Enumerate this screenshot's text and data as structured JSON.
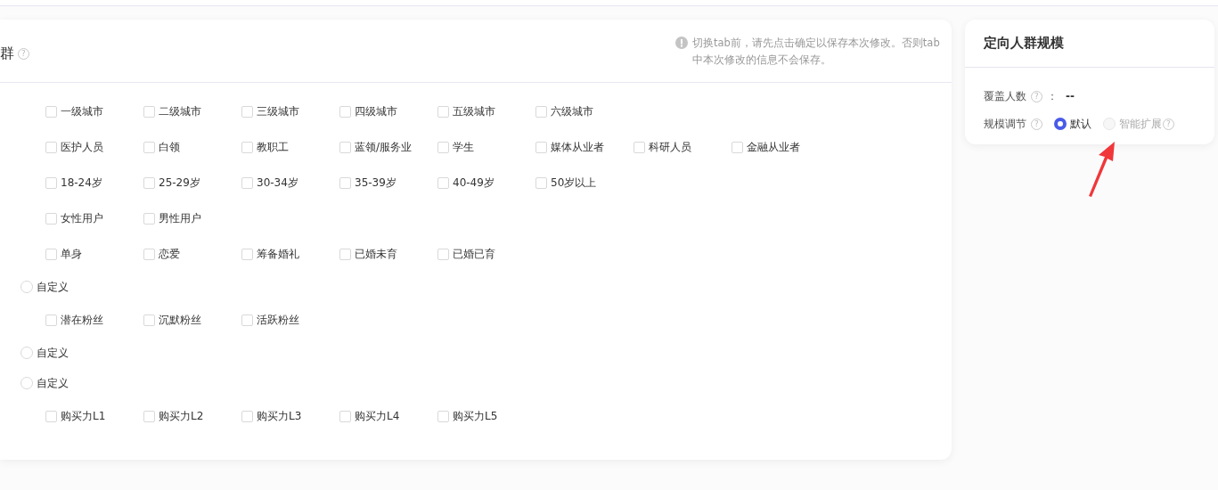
{
  "section": {
    "title": "群",
    "help": "?",
    "notice": "切换tab前，请先点击确定以保存本次修改。否则tab中本次修改的信息不会保存。",
    "rows": [
      {
        "kind": "checkboxes",
        "options": [
          {
            "label": "一级城市",
            "checked": false
          },
          {
            "label": "二级城市",
            "checked": false
          },
          {
            "label": "三级城市",
            "checked": false
          },
          {
            "label": "四级城市",
            "checked": false
          },
          {
            "label": "五级城市",
            "checked": false
          },
          {
            "label": "六级城市",
            "checked": false
          }
        ]
      },
      {
        "kind": "checkboxes",
        "options": [
          {
            "label": "医护人员",
            "checked": false
          },
          {
            "label": "白领",
            "checked": false
          },
          {
            "label": "教职工",
            "checked": false
          },
          {
            "label": "蓝领/服务业",
            "checked": false
          },
          {
            "label": "学生",
            "checked": false
          },
          {
            "label": "媒体从业者",
            "checked": false
          },
          {
            "label": "科研人员",
            "checked": false
          },
          {
            "label": "金融从业者",
            "checked": false
          }
        ]
      },
      {
        "kind": "checkboxes",
        "options": [
          {
            "label": "18-24岁",
            "checked": false
          },
          {
            "label": "25-29岁",
            "checked": false
          },
          {
            "label": "30-34岁",
            "checked": false
          },
          {
            "label": "35-39岁",
            "checked": false
          },
          {
            "label": "40-49岁",
            "checked": false
          },
          {
            "label": "50岁以上",
            "checked": false
          }
        ]
      },
      {
        "kind": "checkboxes",
        "options": [
          {
            "label": "女性用户",
            "checked": false
          },
          {
            "label": "男性用户",
            "checked": false
          }
        ]
      },
      {
        "kind": "checkboxes",
        "options": [
          {
            "label": "单身",
            "checked": false
          },
          {
            "label": "恋爱",
            "checked": false
          },
          {
            "label": "筹备婚礼",
            "checked": false
          },
          {
            "label": "已婚未育",
            "checked": false
          },
          {
            "label": "已婚已育",
            "checked": false
          }
        ]
      },
      {
        "kind": "radio",
        "label": "自定义",
        "selected": false
      },
      {
        "kind": "checkboxes",
        "options": [
          {
            "label": "潜在粉丝",
            "checked": false
          },
          {
            "label": "沉默粉丝",
            "checked": false
          },
          {
            "label": "活跃粉丝",
            "checked": false
          }
        ]
      },
      {
        "kind": "radio",
        "label": "自定义",
        "selected": false
      },
      {
        "kind": "radio",
        "label": "自定义",
        "selected": false
      },
      {
        "kind": "checkboxes",
        "options": [
          {
            "label": "购买力L1",
            "checked": false
          },
          {
            "label": "购买力L2",
            "checked": false
          },
          {
            "label": "购买力L3",
            "checked": false
          },
          {
            "label": "购买力L4",
            "checked": false
          },
          {
            "label": "购买力L5",
            "checked": false
          }
        ]
      }
    ]
  },
  "scale_panel": {
    "title": "定向人群规模",
    "coverage": {
      "label": "覆盖人数",
      "help": "?",
      "separator": "：",
      "value": "--"
    },
    "adjust": {
      "label": "规模调节",
      "help": "?",
      "options": [
        {
          "label": "默认",
          "selected": true,
          "disabled": false
        },
        {
          "label": "智能扩展",
          "selected": false,
          "disabled": true,
          "help": "?"
        }
      ]
    }
  }
}
